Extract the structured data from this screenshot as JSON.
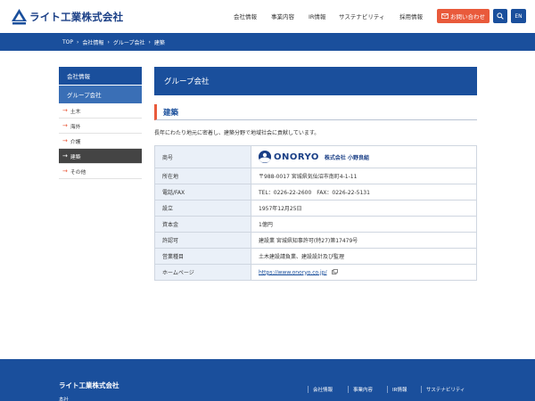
{
  "header": {
    "logo_text": "ライト工業株式会社",
    "nav": [
      "会社情報",
      "事業内容",
      "IR情報",
      "サステナビリティ",
      "採用情報"
    ],
    "contact_label": "お問い合わせ",
    "lang_label": "EN"
  },
  "breadcrumb": [
    "TOP",
    "会社情報",
    "グループ会社",
    "建築"
  ],
  "sidebar": {
    "heading": "会社情報",
    "subheading": "グループ会社",
    "items": [
      {
        "label": "土木",
        "active": false
      },
      {
        "label": "海外",
        "active": false
      },
      {
        "label": "介護",
        "active": false
      },
      {
        "label": "建築",
        "active": true
      },
      {
        "label": "その他",
        "active": false
      }
    ]
  },
  "main": {
    "page_title": "グループ会社",
    "section_title": "建築",
    "lead": "長年にわたり地元に密着し、建築分野で地域社会に貢献しています。",
    "company_logo_word": "ONORYO",
    "company_logo_jp": "株式会社 小野良組",
    "rows": [
      {
        "key": "商号",
        "value": ""
      },
      {
        "key": "所在地",
        "value": "〒988-0017 宮城県気仙沼市南町4-1-11"
      },
      {
        "key": "電話/FAX",
        "value": "TEL：0226-22-2600　FAX：0226-22-5131"
      },
      {
        "key": "設立",
        "value": "1957年12月25日"
      },
      {
        "key": "資本金",
        "value": "1億円"
      },
      {
        "key": "許認可",
        "value": "建設業 宮城県知事許可(特27)第17479号"
      },
      {
        "key": "営業種目",
        "value": "土木建設請負業、建設設計及び監理"
      },
      {
        "key": "ホームページ",
        "value": "https://www.onoryo.co.jp/"
      }
    ]
  },
  "footer": {
    "company_name": "ライト工業株式会社",
    "sub": "本社",
    "nav": [
      "会社情報",
      "事業内容",
      "IR情報",
      "サステナビリティ"
    ]
  },
  "colors": {
    "brand_blue": "#1a4f9c",
    "accent_orange": "#e95a3b",
    "table_key_bg": "#eaf0f8"
  },
  "icons": [
    "mail-icon",
    "search-icon",
    "external-link-icon",
    "arrow-right-icon"
  ]
}
